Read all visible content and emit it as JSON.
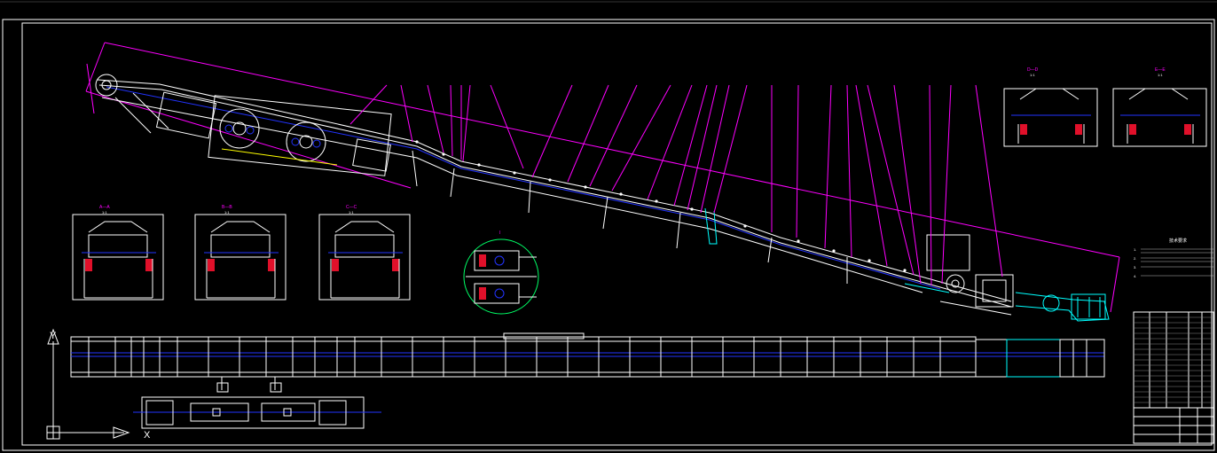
{
  "drawing": {
    "axis_labels": {
      "y": "Y",
      "x": "X"
    },
    "section_views": [
      {
        "id": "A-A",
        "label": "A—A",
        "scale": "1:1"
      },
      {
        "id": "B-B",
        "label": "B—B",
        "scale": "1:1"
      },
      {
        "id": "C-C",
        "label": "C—C",
        "scale": "1:1"
      },
      {
        "id": "D-D",
        "label": "D—D",
        "scale": "1:1"
      },
      {
        "id": "E-E",
        "label": "E—E",
        "scale": "1:1"
      }
    ],
    "detail_view": {
      "label": "I"
    },
    "notes": {
      "title": "技术要求",
      "lines": [
        "1.",
        "2.",
        "3.",
        "4."
      ]
    },
    "colors": {
      "background": "#000000",
      "outline": "#ffffff",
      "leaders": "#ff00ff",
      "belt": "#2233ff",
      "tail": "#00ffff",
      "detail_circle": "#00ff66",
      "idler": "#e0102a",
      "hatch": "#ffff00"
    }
  }
}
